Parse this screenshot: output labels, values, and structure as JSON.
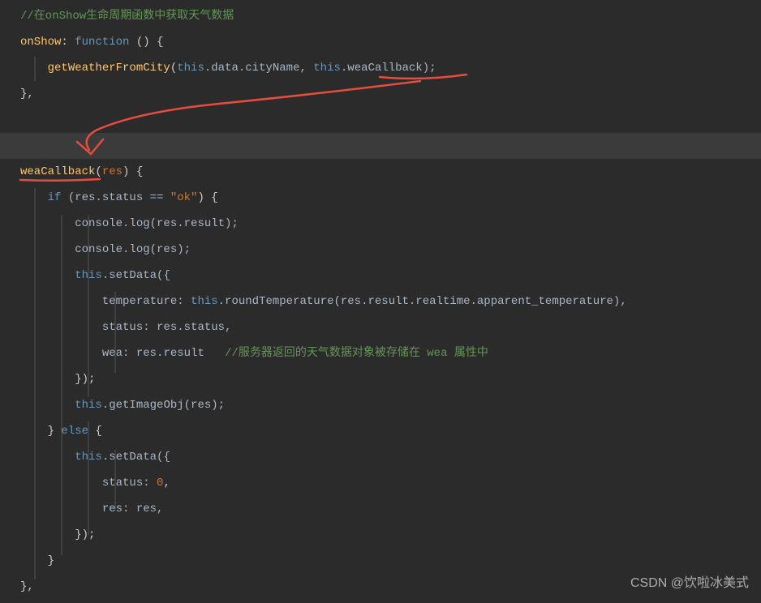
{
  "code": {
    "line1": "//在onShow生命周期函数中获取天气数据",
    "line2_onShow": "onShow",
    "line2_colon": ": ",
    "line2_function": "function",
    "line2_parens": " () {",
    "line3_func": "getWeatherFromCity",
    "line3_open": "(",
    "line3_this1": "this",
    "line3_mid1": ".data.cityName, ",
    "line3_this2": "this",
    "line3_mid2": ".weaCallback);",
    "line4": "},",
    "line5_func": "weaCallback",
    "line5_open": "(",
    "line5_res": "res",
    "line5_close": ") {",
    "line6_if": "if",
    "line6_open": " (res.status == ",
    "line6_str": "\"ok\"",
    "line6_close": ") {",
    "line7_console": "console.log(res.result);",
    "line8_console": "console.log(res);",
    "line9_this": "this",
    "line9_setdata": ".setData({",
    "line10_key": "temperature: ",
    "line10_this": "this",
    "line10_method": ".roundTemperature(res.result.realtime.apparent_temperature),",
    "line11": "status: res.status,",
    "line12_key": "wea: res.result",
    "line12_comment": "   //服务器返回的天气数据对象被存储在 wea 属性中",
    "line13": "});",
    "line14_this": "this",
    "line14_rest": ".getImageObj(res);",
    "line15_close": "} ",
    "line15_else": "else",
    "line15_open": " {",
    "line16_this": "this",
    "line16_rest": ".setData({",
    "line17_key": "status: ",
    "line17_val": "0",
    "line17_comma": ",",
    "line18": "res: res,",
    "line19": "});",
    "line20": "}",
    "line21": "},"
  },
  "watermark": "CSDN @饮啦冰美式"
}
